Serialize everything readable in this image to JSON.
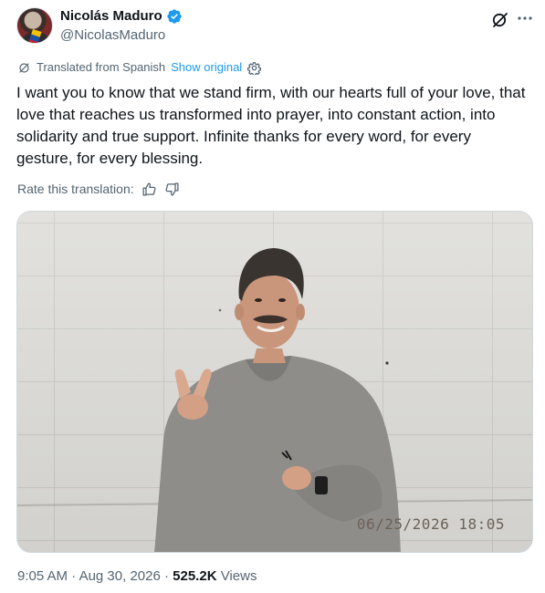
{
  "author": {
    "display_name": "Nicolás Maduro",
    "handle": "@NicolasMaduro",
    "verified": true,
    "verified_color": "#1d9bf0"
  },
  "translation": {
    "label": "Translated from Spanish",
    "show_original": "Show original",
    "rate_label": "Rate this translation:"
  },
  "tweet": {
    "text": "I want you to know that we stand firm, with our hearts full of your love, that love that reaches us transformed into prayer, into constant action, into solidarity and true support. Infinite thanks for every word, for every gesture, for every blessing."
  },
  "media": {
    "timestamp_overlay": "06/25/2026 18:05"
  },
  "meta": {
    "time": "9:05 AM",
    "separator": " · ",
    "date": "Aug 30, 2026",
    "views_count": "525.2K",
    "views_label": " Views"
  },
  "icons": {
    "grok": "grok-icon",
    "more": "more-icon",
    "translate": "translate-icon",
    "settings": "gear-icon",
    "thumbs_up": "thumbs-up-icon",
    "thumbs_down": "thumbs-down-icon"
  },
  "colors": {
    "text_primary": "#0f1419",
    "text_secondary": "#536471",
    "link": "#1d9bf0"
  }
}
